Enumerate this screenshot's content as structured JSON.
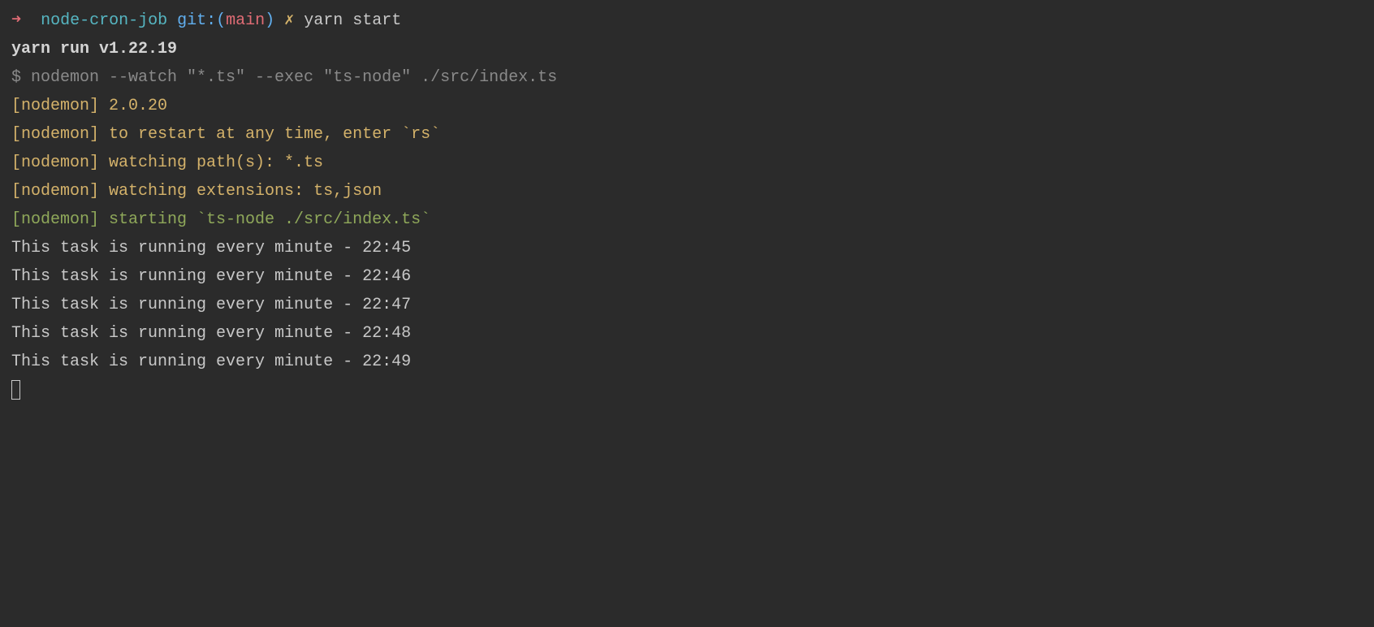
{
  "prompt": {
    "arrow": "➜",
    "dir": "node-cron-job",
    "git_label": "git:(",
    "branch": "main",
    "git_close": ")",
    "dirty": "✗",
    "command": "yarn start"
  },
  "yarn_run": "yarn run v1.22.19",
  "subcommand": "$ nodemon --watch \"*.ts\" --exec \"ts-node\" ./src/index.ts",
  "nodemon": {
    "version": "[nodemon] 2.0.20",
    "restart": "[nodemon] to restart at any time, enter `rs`",
    "watching_paths": "[nodemon] watching path(s): *.ts",
    "watching_ext": "[nodemon] watching extensions: ts,json",
    "starting": "[nodemon] starting `ts-node ./src/index.ts`"
  },
  "output": [
    "This task is running every minute - 22:45",
    "This task is running every minute - 22:46",
    "This task is running every minute - 22:47",
    "This task is running every minute - 22:48",
    "This task is running every minute - 22:49"
  ]
}
